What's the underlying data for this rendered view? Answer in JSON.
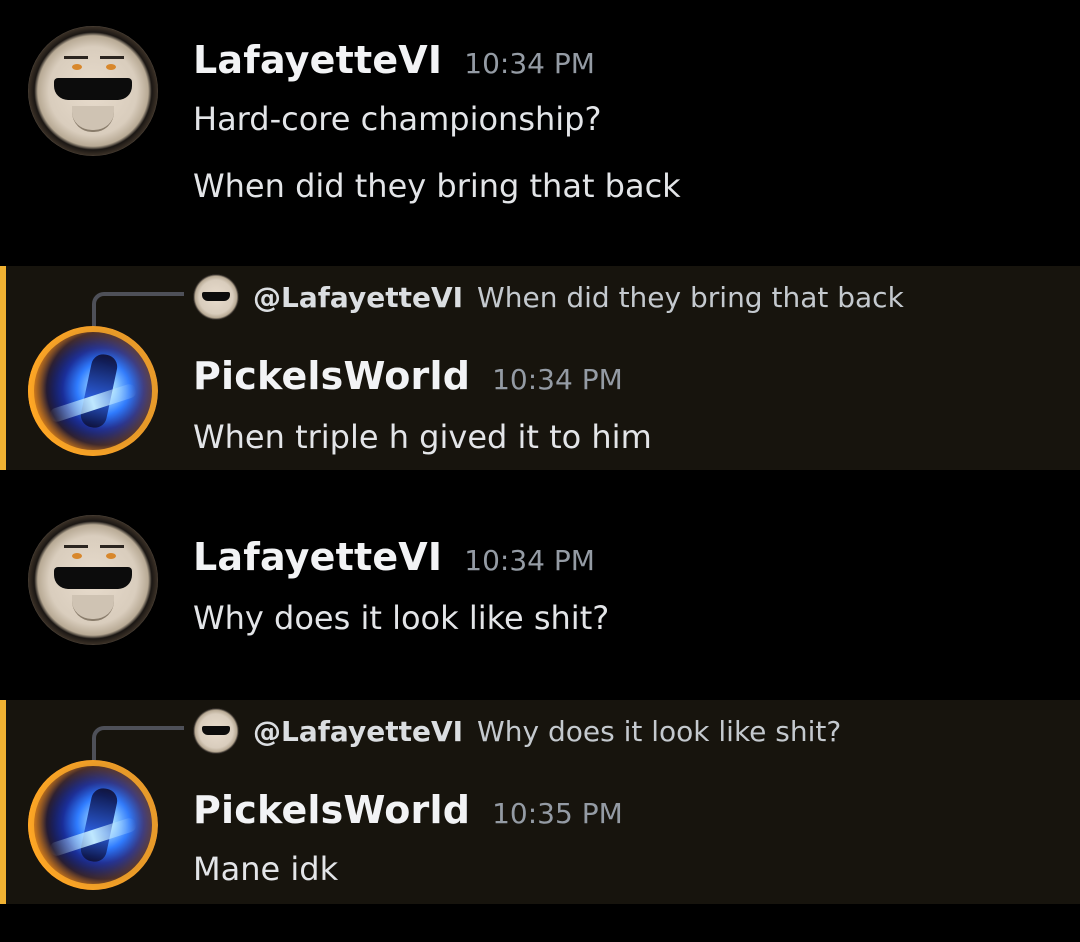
{
  "messages": [
    {
      "username": "LafayetteVI",
      "time": "10:34 PM",
      "lines": [
        "Hard-core championship?",
        "When did they bring that back"
      ],
      "avatar_icon": "lafayette-avatar"
    },
    {
      "username": "PickelsWorld",
      "time": "10:34 PM",
      "lines": [
        "When triple h gived it to him"
      ],
      "reply": {
        "name": "@LafayetteVI",
        "text": "When did they bring that back"
      },
      "avatar_icon": "pickelsworld-avatar"
    },
    {
      "username": "LafayetteVI",
      "time": "10:34 PM",
      "lines": [
        "Why does it look like shit?"
      ],
      "avatar_icon": "lafayette-avatar"
    },
    {
      "username": "PickelsWorld",
      "time": "10:35 PM",
      "lines": [
        "Mane idk"
      ],
      "reply": {
        "name": "@LafayetteVI",
        "text": "Why does it look like shit?"
      },
      "avatar_icon": "pickelsworld-avatar"
    }
  ],
  "colors": {
    "background": "#000000",
    "mention_background": "#17140d",
    "mention_bar": "#f0b232",
    "username": "#f2f3f5",
    "timestamp": "#949ba4"
  }
}
